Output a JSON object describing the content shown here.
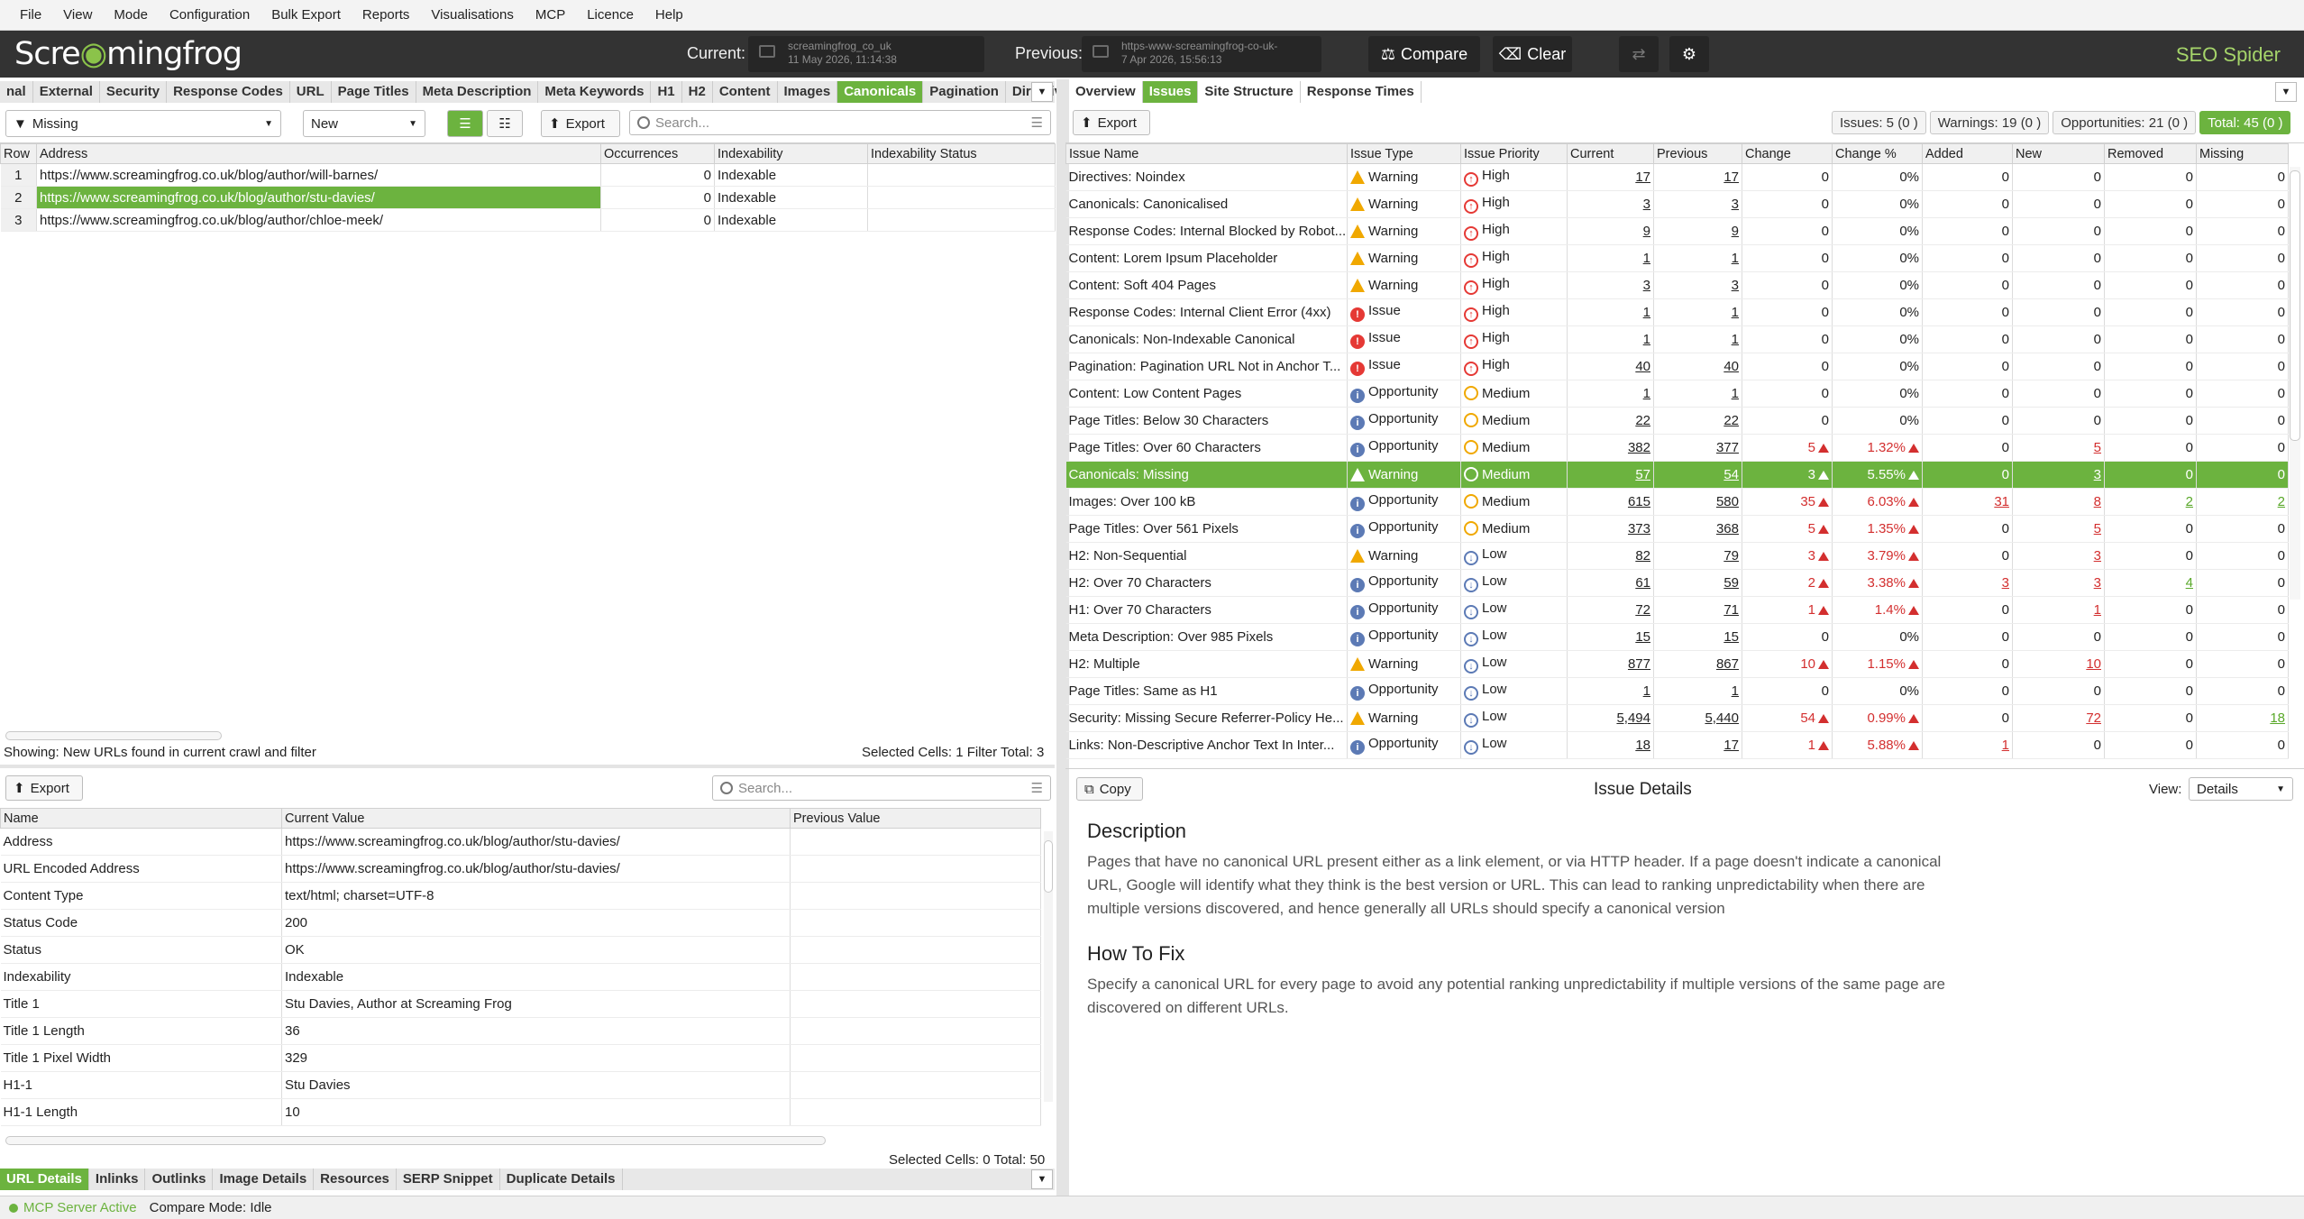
{
  "menu": [
    "File",
    "View",
    "Mode",
    "Configuration",
    "Bulk Export",
    "Reports",
    "Visualisations",
    "MCP",
    "Licence",
    "Help"
  ],
  "header": {
    "logo_a": "Scre",
    "logo_b": "mingfrog",
    "current_label": "Current:",
    "current_site": "screamingfrog_co_uk",
    "current_date": "11 May 2026, 11:14:38",
    "previous_label": "Previous:",
    "previous_site": "https-www-screamingfrog-co-uk-",
    "previous_date": "7 Apr 2026, 15:56:13",
    "compare": "Compare",
    "clear": "Clear",
    "brand": "SEO Spider"
  },
  "left_tabs": [
    "nal",
    "External",
    "Security",
    "Response Codes",
    "URL",
    "Page Titles",
    "Meta Description",
    "Meta Keywords",
    "H1",
    "H2",
    "Content",
    "Images",
    "Canonicals",
    "Pagination",
    "Directiv"
  ],
  "left_active_tab": "Canonicals",
  "left_toolbar": {
    "filter": "Missing",
    "change": "New",
    "export": "Export",
    "search_placeholder": "Search..."
  },
  "url_table": {
    "columns": [
      "Row",
      "Address",
      "Occurrences",
      "Indexability",
      "Indexability Status"
    ],
    "rows": [
      {
        "row": "1",
        "address": "https://www.screamingfrog.co.uk/blog/author/will-barnes/",
        "occ": "0",
        "idx": "Indexable",
        "status": ""
      },
      {
        "row": "2",
        "address": "https://www.screamingfrog.co.uk/blog/author/stu-davies/",
        "occ": "0",
        "idx": "Indexable",
        "status": ""
      },
      {
        "row": "3",
        "address": "https://www.screamingfrog.co.uk/blog/author/chloe-meek/",
        "occ": "0",
        "idx": "Indexable",
        "status": ""
      }
    ]
  },
  "left_status": {
    "showing": "Showing: New URLs found in current crawl and filter",
    "selected": "Selected Cells:  1  Filter Total:  3"
  },
  "details": {
    "export": "Export",
    "search_placeholder": "Search...",
    "columns": [
      "Name",
      "Current Value",
      "Previous Value"
    ],
    "rows": [
      {
        "name": "Address",
        "cur": "https://www.screamingfrog.co.uk/blog/author/stu-davies/",
        "prev": ""
      },
      {
        "name": "URL Encoded Address",
        "cur": "https://www.screamingfrog.co.uk/blog/author/stu-davies/",
        "prev": ""
      },
      {
        "name": "Content Type",
        "cur": "text/html; charset=UTF-8",
        "prev": ""
      },
      {
        "name": "Status Code",
        "cur": "200",
        "prev": ""
      },
      {
        "name": "Status",
        "cur": "OK",
        "prev": ""
      },
      {
        "name": "Indexability",
        "cur": "Indexable",
        "prev": ""
      },
      {
        "name": "Title 1",
        "cur": "Stu Davies, Author at Screaming Frog",
        "prev": ""
      },
      {
        "name": "Title 1 Length",
        "cur": "36",
        "prev": ""
      },
      {
        "name": "Title 1 Pixel Width",
        "cur": "329",
        "prev": ""
      },
      {
        "name": "H1-1",
        "cur": "Stu Davies",
        "prev": ""
      },
      {
        "name": "H1-1 Length",
        "cur": "10",
        "prev": ""
      }
    ],
    "status": "Selected Cells:  0  Total:  50"
  },
  "bottom_tabs": [
    "URL Details",
    "Inlinks",
    "Outlinks",
    "Image Details",
    "Resources",
    "SERP Snippet",
    "Duplicate Details"
  ],
  "bottom_active": "URL Details",
  "footer": {
    "mcp": "MCP Server Active",
    "compare_mode": "Compare Mode: Idle"
  },
  "right_tabs": [
    "Overview",
    "Issues",
    "Site Structure",
    "Response Times"
  ],
  "right_active": "Issues",
  "right_toolbar": {
    "export": "Export"
  },
  "counts": {
    "issues": "Issues: 5 (0 )",
    "warnings": "Warnings: 19 (0 )",
    "opportunities": "Opportunities: 21 (0 )",
    "total": "Total: 45 (0 )"
  },
  "issues_table": {
    "columns": [
      "Issue Name",
      "Issue Type",
      "Issue Priority",
      "Current",
      "Previous",
      "Change",
      "Change %",
      "Added",
      "New",
      "Removed",
      "Missing"
    ],
    "rows": [
      {
        "name": "Directives: Noindex",
        "type": "Warning",
        "prio": "High",
        "cur": "17",
        "prev": "17",
        "chg": "0",
        "pct": "0%",
        "up": false,
        "added": "0",
        "new": "0",
        "removed": "0",
        "missing": "0"
      },
      {
        "name": "Canonicals: Canonicalised",
        "type": "Warning",
        "prio": "High",
        "cur": "3",
        "prev": "3",
        "chg": "0",
        "pct": "0%",
        "up": false,
        "added": "0",
        "new": "0",
        "removed": "0",
        "missing": "0"
      },
      {
        "name": "Response Codes: Internal Blocked by Robot...",
        "type": "Warning",
        "prio": "High",
        "cur": "9",
        "prev": "9",
        "chg": "0",
        "pct": "0%",
        "up": false,
        "added": "0",
        "new": "0",
        "removed": "0",
        "missing": "0"
      },
      {
        "name": "Content: Lorem Ipsum Placeholder",
        "type": "Warning",
        "prio": "High",
        "cur": "1",
        "prev": "1",
        "chg": "0",
        "pct": "0%",
        "up": false,
        "added": "0",
        "new": "0",
        "removed": "0",
        "missing": "0"
      },
      {
        "name": "Content: Soft 404 Pages",
        "type": "Warning",
        "prio": "High",
        "cur": "3",
        "prev": "3",
        "chg": "0",
        "pct": "0%",
        "up": false,
        "added": "0",
        "new": "0",
        "removed": "0",
        "missing": "0"
      },
      {
        "name": "Response Codes: Internal Client Error (4xx)",
        "type": "Issue",
        "prio": "High",
        "cur": "1",
        "prev": "1",
        "chg": "0",
        "pct": "0%",
        "up": false,
        "added": "0",
        "new": "0",
        "removed": "0",
        "missing": "0"
      },
      {
        "name": "Canonicals: Non-Indexable Canonical",
        "type": "Issue",
        "prio": "High",
        "cur": "1",
        "prev": "1",
        "chg": "0",
        "pct": "0%",
        "up": false,
        "added": "0",
        "new": "0",
        "removed": "0",
        "missing": "0"
      },
      {
        "name": "Pagination: Pagination URL Not in Anchor T...",
        "type": "Issue",
        "prio": "High",
        "cur": "40",
        "prev": "40",
        "chg": "0",
        "pct": "0%",
        "up": false,
        "added": "0",
        "new": "0",
        "removed": "0",
        "missing": "0"
      },
      {
        "name": "Content: Low Content Pages",
        "type": "Opportunity",
        "prio": "Medium",
        "cur": "1",
        "prev": "1",
        "chg": "0",
        "pct": "0%",
        "up": false,
        "added": "0",
        "new": "0",
        "removed": "0",
        "missing": "0"
      },
      {
        "name": "Page Titles: Below 30 Characters",
        "type": "Opportunity",
        "prio": "Medium",
        "cur": "22",
        "prev": "22",
        "chg": "0",
        "pct": "0%",
        "up": false,
        "added": "0",
        "new": "0",
        "removed": "0",
        "missing": "0"
      },
      {
        "name": "Page Titles: Over 60 Characters",
        "type": "Opportunity",
        "prio": "Medium",
        "cur": "382",
        "prev": "377",
        "chg": "5",
        "pct": "1.32%",
        "up": true,
        "added": "0",
        "new": "5",
        "removed": "0",
        "missing": "0"
      },
      {
        "name": "Canonicals: Missing",
        "type": "Warning",
        "prio": "Medium",
        "cur": "57",
        "prev": "54",
        "chg": "3",
        "pct": "5.55%",
        "up": true,
        "added": "0",
        "new": "3",
        "removed": "0",
        "missing": "0",
        "selected": true
      },
      {
        "name": "Images: Over 100 kB",
        "type": "Opportunity",
        "prio": "Medium",
        "cur": "615",
        "prev": "580",
        "chg": "35",
        "pct": "6.03%",
        "up": true,
        "added": "31",
        "new": "8",
        "removed": "2",
        "missing": "2"
      },
      {
        "name": "Page Titles: Over 561 Pixels",
        "type": "Opportunity",
        "prio": "Medium",
        "cur": "373",
        "prev": "368",
        "chg": "5",
        "pct": "1.35%",
        "up": true,
        "added": "0",
        "new": "5",
        "removed": "0",
        "missing": "0"
      },
      {
        "name": "H2: Non-Sequential",
        "type": "Warning",
        "prio": "Low",
        "cur": "82",
        "prev": "79",
        "chg": "3",
        "pct": "3.79%",
        "up": true,
        "added": "0",
        "new": "3",
        "removed": "0",
        "missing": "0"
      },
      {
        "name": "H2: Over 70 Characters",
        "type": "Opportunity",
        "prio": "Low",
        "cur": "61",
        "prev": "59",
        "chg": "2",
        "pct": "3.38%",
        "up": true,
        "added": "3",
        "new": "3",
        "removed": "4",
        "missing": "0"
      },
      {
        "name": "H1: Over 70 Characters",
        "type": "Opportunity",
        "prio": "Low",
        "cur": "72",
        "prev": "71",
        "chg": "1",
        "pct": "1.4%",
        "up": true,
        "added": "0",
        "new": "1",
        "removed": "0",
        "missing": "0"
      },
      {
        "name": "Meta Description: Over 985 Pixels",
        "type": "Opportunity",
        "prio": "Low",
        "cur": "15",
        "prev": "15",
        "chg": "0",
        "pct": "0%",
        "up": false,
        "added": "0",
        "new": "0",
        "removed": "0",
        "missing": "0"
      },
      {
        "name": "H2: Multiple",
        "type": "Warning",
        "prio": "Low",
        "cur": "877",
        "prev": "867",
        "chg": "10",
        "pct": "1.15%",
        "up": true,
        "added": "0",
        "new": "10",
        "removed": "0",
        "missing": "0"
      },
      {
        "name": "Page Titles: Same as H1",
        "type": "Opportunity",
        "prio": "Low",
        "cur": "1",
        "prev": "1",
        "chg": "0",
        "pct": "0%",
        "up": false,
        "added": "0",
        "new": "0",
        "removed": "0",
        "missing": "0"
      },
      {
        "name": "Security: Missing Secure Referrer-Policy He...",
        "type": "Warning",
        "prio": "Low",
        "cur": "5,494",
        "prev": "5,440",
        "chg": "54",
        "pct": "0.99%",
        "up": true,
        "added": "0",
        "new": "72",
        "removed": "0",
        "missing": "18"
      },
      {
        "name": "Links: Non-Descriptive Anchor Text In Inter...",
        "type": "Opportunity",
        "prio": "Low",
        "cur": "18",
        "prev": "17",
        "chg": "1",
        "pct": "5.88%",
        "up": true,
        "added": "1",
        "new": "0",
        "removed": "0",
        "missing": "0"
      }
    ]
  },
  "issue_details": {
    "copy": "Copy",
    "title": "Issue Details",
    "view_label": "View:",
    "view_value": "Details",
    "desc_heading": "Description",
    "desc_text": "Pages that have no canonical URL present either as a link element, or via HTTP header. If a page doesn't indicate a canonical URL, Google will identify what they think is the best version or URL. This can lead to ranking unpredictability when there are multiple versions discovered, and hence generally all URLs should specify a canonical version",
    "fix_heading": "How To Fix",
    "fix_text": "Specify a canonical URL for every page to avoid any potential ranking unpredictability if multiple versions of the same page are discovered on different URLs."
  },
  "colors": {
    "accent": "#6cb33f",
    "header_bg": "#333333",
    "red": "#d32f2f",
    "warning": "#f0a800"
  }
}
